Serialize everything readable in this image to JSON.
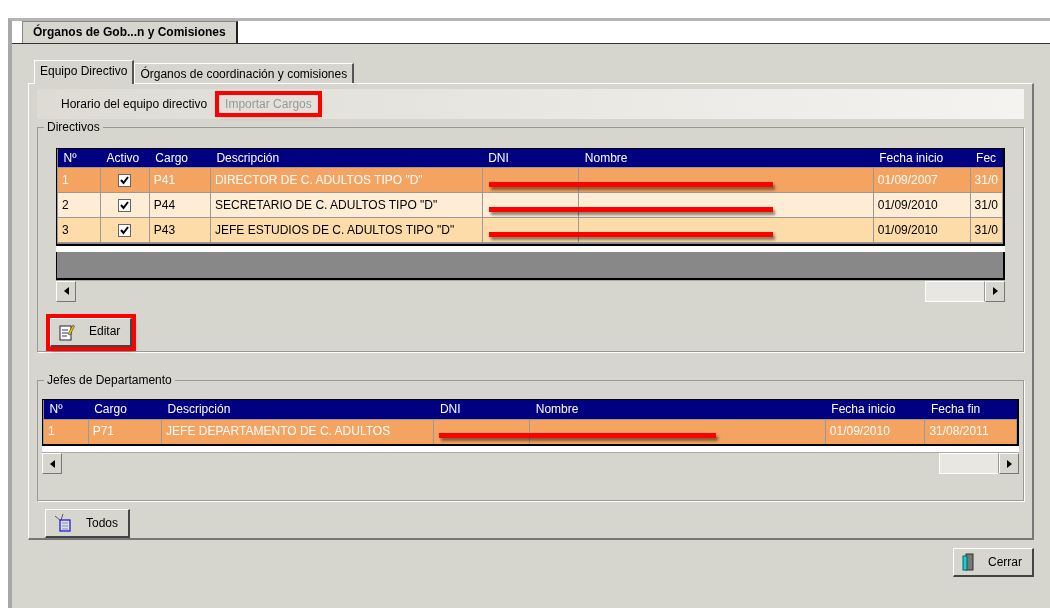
{
  "window_tab": {
    "label": "Órganos de Gob...n y Comisiones",
    "selected": true
  },
  "tabs": [
    {
      "label": "Equipo Directivo",
      "selected": true
    },
    {
      "label": "Órganos de coordinación y comisiones",
      "selected": false
    }
  ],
  "toolbar": [
    {
      "label": "Horario del equipo directivo",
      "disabled": false,
      "highlighted": false
    },
    {
      "label": "Importar Cargos",
      "disabled": true,
      "highlighted": true
    }
  ],
  "directivos": {
    "title": "Directivos",
    "columns": [
      {
        "label": "Nº",
        "kind": "text"
      },
      {
        "label": "Activo",
        "kind": "check"
      },
      {
        "label": "Cargo",
        "kind": "text"
      },
      {
        "label": "Descripción",
        "kind": "text"
      },
      {
        "label": "DNI",
        "kind": "redacted"
      },
      {
        "label": "Nombre",
        "kind": "redacted"
      },
      {
        "label": "Fecha inicio",
        "kind": "text"
      },
      {
        "label": "Fec",
        "kind": "text"
      }
    ],
    "rows": [
      {
        "selected": true,
        "activo": true,
        "cells": [
          "1",
          "",
          "P41",
          "DIRECTOR DE C. ADULTOS TIPO \"D\"",
          "",
          "",
          "01/09/2007",
          "31/0"
        ]
      },
      {
        "selected": false,
        "activo": true,
        "cells": [
          "2",
          "",
          "P44",
          "SECRETARIO DE C. ADULTOS TIPO \"D\"",
          "",
          "",
          "01/09/2010",
          "31/0"
        ]
      },
      {
        "selected": false,
        "activo": true,
        "cells": [
          "3",
          "",
          "P43",
          "JEFE ESTUDIOS DE C. ADULTOS TIPO \"D\"",
          "",
          "",
          "01/09/2010",
          "31/0"
        ]
      }
    ]
  },
  "edit_button": {
    "label": "Editar",
    "highlighted": true
  },
  "jefes": {
    "title": "Jefes de Departamento",
    "columns": [
      {
        "label": "Nº",
        "kind": "text"
      },
      {
        "label": "Cargo",
        "kind": "text"
      },
      {
        "label": "Descripción",
        "kind": "text"
      },
      {
        "label": "DNI",
        "kind": "redacted"
      },
      {
        "label": "Nombre",
        "kind": "redacted"
      },
      {
        "label": "Fecha inicio",
        "kind": "text"
      },
      {
        "label": "Fecha fin",
        "kind": "text"
      }
    ],
    "rows": [
      {
        "selected": true,
        "cells": [
          "1",
          "P71",
          "JEFE DEPARTAMENTO DE C. ADULTOS",
          "",
          "",
          "01/09/2010",
          "31/08/2011"
        ]
      }
    ]
  },
  "all_button": {
    "label": "Todos"
  },
  "close_button": {
    "label": "Cerrar"
  }
}
